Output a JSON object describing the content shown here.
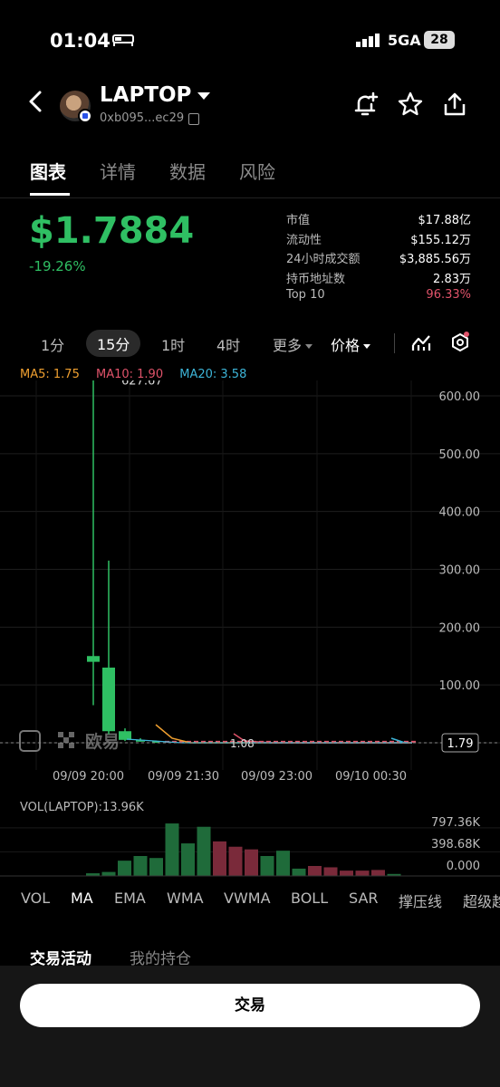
{
  "status_bar": {
    "time": "01:04",
    "network": "5GA",
    "battery": "28"
  },
  "header": {
    "token_name": "LAPTOP",
    "address": "0xb095...ec29"
  },
  "tabs": [
    "图表",
    "详情",
    "数据",
    "风险"
  ],
  "price": {
    "current": "$1.7884",
    "change": "-19.26%"
  },
  "stats": [
    {
      "label": "市值",
      "value": "$17.88亿"
    },
    {
      "label": "流动性",
      "value": "$155.12万"
    },
    {
      "label": "24小时成交额",
      "value": "$3,885.56万"
    },
    {
      "label": "持币地址数",
      "value": "2.83万"
    },
    {
      "label": "Top 10",
      "value": "96.33%"
    }
  ],
  "intervals": {
    "i1": "1分",
    "i2": "15分",
    "i3": "1时",
    "i4": "4时",
    "more": "更多",
    "price": "价格"
  },
  "ma_legend": {
    "ma5": "MA5: 1.75",
    "ma10": "MA10: 1.90",
    "ma20": "MA20: 3.58"
  },
  "colors": {
    "up": "#2fbf63",
    "down": "#e0536a",
    "ma5": "#f0a030",
    "ma10": "#e0536a",
    "ma20": "#3db5d8"
  },
  "chart_data": {
    "type": "candlestick",
    "ylim": [
      0,
      650
    ],
    "y_ticks": [
      "600.00",
      "500.00",
      "400.00",
      "300.00",
      "200.00",
      "100.00"
    ],
    "x_ticks": [
      "09/09 20:00",
      "09/09 21:30",
      "09/09 23:00",
      "09/10 00:30"
    ],
    "high_label": "627.67",
    "low_label": "1.08",
    "last_price": "1.79",
    "watermark": "欧易",
    "candles": [
      {
        "open": 140,
        "close": 150,
        "high": 627.67,
        "low": 65,
        "dir": "up"
      },
      {
        "open": 130,
        "close": 20,
        "high": 315,
        "low": 15,
        "dir": "up"
      },
      {
        "open": 20,
        "close": 5,
        "high": 25,
        "low": 3,
        "dir": "up"
      },
      {
        "open": 5,
        "close": 3,
        "high": 8,
        "low": 2,
        "dir": "up"
      },
      {
        "open": 3,
        "close": 2.5,
        "high": 4,
        "low": 2,
        "dir": "up"
      }
    ],
    "volume_label": "VOL(LAPTOP):13.96K",
    "volume_ticks": [
      "797.36K",
      "398.68K",
      "0.000"
    ],
    "volume_ymax": 900,
    "volumes": [
      {
        "v": 40,
        "dir": "up"
      },
      {
        "v": 60,
        "dir": "up"
      },
      {
        "v": 230,
        "dir": "up"
      },
      {
        "v": 300,
        "dir": "up"
      },
      {
        "v": 270,
        "dir": "up"
      },
      {
        "v": 790,
        "dir": "up"
      },
      {
        "v": 490,
        "dir": "up"
      },
      {
        "v": 740,
        "dir": "up"
      },
      {
        "v": 520,
        "dir": "down"
      },
      {
        "v": 440,
        "dir": "down"
      },
      {
        "v": 400,
        "dir": "down"
      },
      {
        "v": 300,
        "dir": "up"
      },
      {
        "v": 380,
        "dir": "up"
      },
      {
        "v": 110,
        "dir": "up"
      },
      {
        "v": 150,
        "dir": "down"
      },
      {
        "v": 130,
        "dir": "down"
      },
      {
        "v": 80,
        "dir": "down"
      },
      {
        "v": 80,
        "dir": "down"
      },
      {
        "v": 90,
        "dir": "down"
      },
      {
        "v": 30,
        "dir": "up"
      }
    ]
  },
  "indicators": [
    "VOL",
    "MA",
    "EMA",
    "WMA",
    "VWMA",
    "BOLL",
    "SAR",
    "撑压线",
    "超级趋"
  ],
  "activity_tabs": [
    "交易活动",
    "我的持仓"
  ],
  "trade_button": "交易"
}
